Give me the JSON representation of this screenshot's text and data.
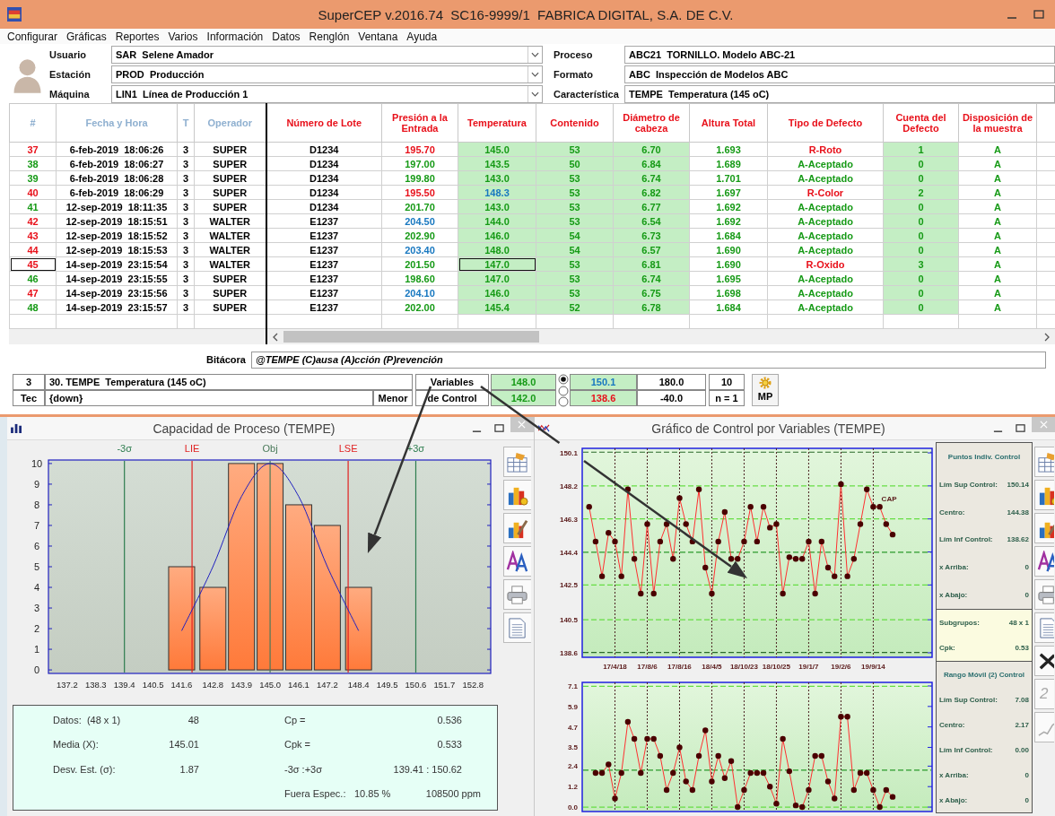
{
  "window": {
    "title": "SuperCEP v.2016.74  SC16-9999/1  FABRICA DIGITAL, S.A. DE C.V."
  },
  "menu": [
    "Configurar",
    "Gráficas",
    "Reportes",
    "Varios",
    "Información",
    "Datos",
    "Renglón",
    "Ventana",
    "Ayuda"
  ],
  "header": {
    "left": [
      {
        "label": "Usuario",
        "value": "SAR  Selene Amador"
      },
      {
        "label": "Estación",
        "value": "PROD  Producción"
      },
      {
        "label": "Máquina",
        "value": "LIN1  Línea de Producción 1"
      }
    ],
    "right": [
      {
        "label": "Proceso",
        "value": "ABC21  TORNILLO. Modelo ABC-21"
      },
      {
        "label": "Formato",
        "value": "ABC  Inspección de Modelos ABC"
      },
      {
        "label": "Característica",
        "value": "TEMPE  Temperatura (145 oC)"
      }
    ]
  },
  "table": {
    "columns": [
      {
        "label": "#",
        "color": "#8fb0d0",
        "shaded": false,
        "focused": false
      },
      {
        "label": "Fecha y Hora",
        "color": "#8fb0d0",
        "shaded": false,
        "focused": false
      },
      {
        "label": "T",
        "color": "#8fb0d0",
        "shaded": false,
        "focused": false
      },
      {
        "label": "Operador",
        "color": "#8fb0d0",
        "shaded": false,
        "focused": false
      },
      {
        "label": "Número de Lote",
        "color": "#e8101a",
        "shaded": false,
        "focused": false
      },
      {
        "label": "Presión a la Entrada",
        "color": "#e8101a",
        "shaded": false,
        "focused": false
      },
      {
        "label": "Temperatura",
        "color": "#e8101a",
        "shaded": true,
        "focused": true
      },
      {
        "label": "Contenido",
        "color": "#e8101a",
        "shaded": true,
        "focused": false
      },
      {
        "label": "Diámetro de cabeza",
        "color": "#e8101a",
        "shaded": true,
        "focused": false
      },
      {
        "label": "Altura Total",
        "color": "#e8101a",
        "shaded": false,
        "focused": false
      },
      {
        "label": "Tipo de Defecto",
        "color": "#e8101a",
        "shaded": false,
        "focused": false
      },
      {
        "label": "Cuenta del Defecto",
        "color": "#e8101a",
        "shaded": true,
        "focused": false
      },
      {
        "label": "Disposición de la muestra",
        "color": "#e8101a",
        "shaded": false,
        "focused": false
      }
    ],
    "rows": [
      {
        "selected": false,
        "cells": [
          {
            "text": "37",
            "color": "#e8101a"
          },
          {
            "text": "6-feb-2019  18:06:26"
          },
          {
            "text": "3"
          },
          {
            "text": "SUPER"
          },
          {
            "text": "D1234"
          },
          {
            "text": "195.70",
            "color": "#e8101a"
          },
          {
            "text": "145.0",
            "color": "#169a16"
          },
          {
            "text": "53",
            "color": "#169a16"
          },
          {
            "text": "6.70",
            "color": "#169a16"
          },
          {
            "text": "1.693",
            "color": "#169a16"
          },
          {
            "text": "R-Roto",
            "color": "#e8101a"
          },
          {
            "text": "1",
            "color": "#169a16"
          },
          {
            "text": "A",
            "color": "#169a16"
          }
        ]
      },
      {
        "selected": false,
        "cells": [
          {
            "text": "38",
            "color": "#169a16"
          },
          {
            "text": "6-feb-2019  18:06:27"
          },
          {
            "text": "3"
          },
          {
            "text": "SUPER"
          },
          {
            "text": "D1234"
          },
          {
            "text": "197.00",
            "color": "#169a16"
          },
          {
            "text": "143.5",
            "color": "#169a16"
          },
          {
            "text": "50",
            "color": "#169a16"
          },
          {
            "text": "6.84",
            "color": "#169a16"
          },
          {
            "text": "1.689",
            "color": "#169a16"
          },
          {
            "text": "A-Aceptado",
            "color": "#169a16"
          },
          {
            "text": "0",
            "color": "#169a16"
          },
          {
            "text": "A",
            "color": "#169a16"
          }
        ]
      },
      {
        "selected": false,
        "cells": [
          {
            "text": "39",
            "color": "#169a16"
          },
          {
            "text": "6-feb-2019  18:06:28"
          },
          {
            "text": "3"
          },
          {
            "text": "SUPER"
          },
          {
            "text": "D1234"
          },
          {
            "text": "199.80",
            "color": "#169a16"
          },
          {
            "text": "143.0",
            "color": "#169a16"
          },
          {
            "text": "53",
            "color": "#169a16"
          },
          {
            "text": "6.74",
            "color": "#169a16"
          },
          {
            "text": "1.701",
            "color": "#169a16"
          },
          {
            "text": "A-Aceptado",
            "color": "#169a16"
          },
          {
            "text": "0",
            "color": "#169a16"
          },
          {
            "text": "A",
            "color": "#169a16"
          }
        ]
      },
      {
        "selected": false,
        "cells": [
          {
            "text": "40",
            "color": "#e8101a"
          },
          {
            "text": "6-feb-2019  18:06:29"
          },
          {
            "text": "3"
          },
          {
            "text": "SUPER"
          },
          {
            "text": "D1234"
          },
          {
            "text": "195.50",
            "color": "#e8101a"
          },
          {
            "text": "148.3",
            "color": "#1878c0"
          },
          {
            "text": "53",
            "color": "#169a16"
          },
          {
            "text": "6.82",
            "color": "#169a16"
          },
          {
            "text": "1.697",
            "color": "#169a16"
          },
          {
            "text": "R-Color",
            "color": "#e8101a"
          },
          {
            "text": "2",
            "color": "#169a16"
          },
          {
            "text": "A",
            "color": "#169a16"
          }
        ]
      },
      {
        "selected": false,
        "cells": [
          {
            "text": "41",
            "color": "#169a16"
          },
          {
            "text": "12-sep-2019  18:11:35"
          },
          {
            "text": "3"
          },
          {
            "text": "SUPER"
          },
          {
            "text": "D1234"
          },
          {
            "text": "201.70",
            "color": "#169a16"
          },
          {
            "text": "143.0",
            "color": "#169a16"
          },
          {
            "text": "53",
            "color": "#169a16"
          },
          {
            "text": "6.77",
            "color": "#169a16"
          },
          {
            "text": "1.692",
            "color": "#169a16"
          },
          {
            "text": "A-Aceptado",
            "color": "#169a16"
          },
          {
            "text": "0",
            "color": "#169a16"
          },
          {
            "text": "A",
            "color": "#169a16"
          }
        ]
      },
      {
        "selected": false,
        "cells": [
          {
            "text": "42",
            "color": "#e8101a"
          },
          {
            "text": "12-sep-2019  18:15:51"
          },
          {
            "text": "3"
          },
          {
            "text": "WALTER"
          },
          {
            "text": "E1237"
          },
          {
            "text": "204.50",
            "color": "#1878c0"
          },
          {
            "text": "144.0",
            "color": "#169a16"
          },
          {
            "text": "53",
            "color": "#169a16"
          },
          {
            "text": "6.54",
            "color": "#169a16"
          },
          {
            "text": "1.692",
            "color": "#169a16"
          },
          {
            "text": "A-Aceptado",
            "color": "#169a16"
          },
          {
            "text": "0",
            "color": "#169a16"
          },
          {
            "text": "A",
            "color": "#169a16"
          }
        ]
      },
      {
        "selected": false,
        "cells": [
          {
            "text": "43",
            "color": "#e8101a"
          },
          {
            "text": "12-sep-2019  18:15:52"
          },
          {
            "text": "3"
          },
          {
            "text": "WALTER"
          },
          {
            "text": "E1237"
          },
          {
            "text": "202.90",
            "color": "#169a16"
          },
          {
            "text": "146.0",
            "color": "#169a16"
          },
          {
            "text": "54",
            "color": "#169a16"
          },
          {
            "text": "6.73",
            "color": "#169a16"
          },
          {
            "text": "1.684",
            "color": "#169a16"
          },
          {
            "text": "A-Aceptado",
            "color": "#169a16"
          },
          {
            "text": "0",
            "color": "#169a16"
          },
          {
            "text": "A",
            "color": "#169a16"
          }
        ]
      },
      {
        "selected": false,
        "cells": [
          {
            "text": "44",
            "color": "#e8101a"
          },
          {
            "text": "12-sep-2019  18:15:53"
          },
          {
            "text": "3"
          },
          {
            "text": "WALTER"
          },
          {
            "text": "E1237"
          },
          {
            "text": "203.40",
            "color": "#1878c0"
          },
          {
            "text": "148.0",
            "color": "#169a16"
          },
          {
            "text": "54",
            "color": "#169a16"
          },
          {
            "text": "6.57",
            "color": "#169a16"
          },
          {
            "text": "1.690",
            "color": "#169a16"
          },
          {
            "text": "A-Aceptado",
            "color": "#169a16"
          },
          {
            "text": "0",
            "color": "#169a16"
          },
          {
            "text": "A",
            "color": "#169a16"
          }
        ]
      },
      {
        "selected": true,
        "cells": [
          {
            "text": "45",
            "color": "#e8101a"
          },
          {
            "text": "14-sep-2019  23:15:54"
          },
          {
            "text": "3"
          },
          {
            "text": "WALTER"
          },
          {
            "text": "E1237"
          },
          {
            "text": "201.50",
            "color": "#169a16"
          },
          {
            "text": "147.0",
            "color": "#169a16"
          },
          {
            "text": "53",
            "color": "#169a16"
          },
          {
            "text": "6.81",
            "color": "#169a16"
          },
          {
            "text": "1.690",
            "color": "#169a16"
          },
          {
            "text": "R-Oxido",
            "color": "#e8101a"
          },
          {
            "text": "3",
            "color": "#169a16"
          },
          {
            "text": "A",
            "color": "#169a16"
          }
        ]
      },
      {
        "selected": false,
        "cells": [
          {
            "text": "46",
            "color": "#169a16"
          },
          {
            "text": "14-sep-2019  23:15:55"
          },
          {
            "text": "3"
          },
          {
            "text": "SUPER"
          },
          {
            "text": "E1237"
          },
          {
            "text": "198.60",
            "color": "#169a16"
          },
          {
            "text": "147.0",
            "color": "#169a16"
          },
          {
            "text": "53",
            "color": "#169a16"
          },
          {
            "text": "6.74",
            "color": "#169a16"
          },
          {
            "text": "1.695",
            "color": "#169a16"
          },
          {
            "text": "A-Aceptado",
            "color": "#169a16"
          },
          {
            "text": "0",
            "color": "#169a16"
          },
          {
            "text": "A",
            "color": "#169a16"
          }
        ]
      },
      {
        "selected": false,
        "cells": [
          {
            "text": "47",
            "color": "#e8101a"
          },
          {
            "text": "14-sep-2019  23:15:56"
          },
          {
            "text": "3"
          },
          {
            "text": "SUPER"
          },
          {
            "text": "E1237"
          },
          {
            "text": "204.10",
            "color": "#1878c0"
          },
          {
            "text": "146.0",
            "color": "#169a16"
          },
          {
            "text": "53",
            "color": "#169a16"
          },
          {
            "text": "6.75",
            "color": "#169a16"
          },
          {
            "text": "1.698",
            "color": "#169a16"
          },
          {
            "text": "A-Aceptado",
            "color": "#169a16"
          },
          {
            "text": "0",
            "color": "#169a16"
          },
          {
            "text": "A",
            "color": "#169a16"
          }
        ]
      },
      {
        "selected": false,
        "cells": [
          {
            "text": "48",
            "color": "#169a16"
          },
          {
            "text": "14-sep-2019  23:15:57"
          },
          {
            "text": "3"
          },
          {
            "text": "SUPER"
          },
          {
            "text": "E1237"
          },
          {
            "text": "202.00",
            "color": "#169a16"
          },
          {
            "text": "145.4",
            "color": "#169a16"
          },
          {
            "text": "52",
            "color": "#169a16"
          },
          {
            "text": "6.78",
            "color": "#169a16"
          },
          {
            "text": "1.684",
            "color": "#169a16"
          },
          {
            "text": "A-Aceptado",
            "color": "#169a16"
          },
          {
            "text": "0",
            "color": "#169a16"
          },
          {
            "text": "A",
            "color": "#169a16"
          }
        ]
      }
    ]
  },
  "log": {
    "label": "Bitácora",
    "value": "@TEMPE (C)ausa (A)cción (P)revención"
  },
  "info_bar": {
    "number": "3",
    "type": "Tec",
    "characteristic": "30. TEMPE  Temperatura (145 oC)",
    "direction": "{down}",
    "unit": "Menor",
    "chart_type": [
      "Variables",
      "de Control"
    ],
    "radios": [
      {
        "selected": true
      },
      {
        "selected": false
      },
      {
        "selected": false
      }
    ],
    "groups": [
      {
        "shaded": true,
        "cells": [
          {
            "text": "148.0",
            "color": "#169a16"
          },
          {
            "text": "142.0",
            "color": "#169a16"
          }
        ]
      },
      {
        "shaded": true,
        "cells": [
          {
            "text": "150.1",
            "color": "#1878c0"
          },
          {
            "text": "138.6",
            "color": "#e8101a"
          }
        ]
      },
      {
        "shaded": false,
        "cells": [
          {
            "text": "180.0",
            "color": "#000000"
          },
          {
            "text": "-40.0",
            "color": "#000000"
          }
        ]
      },
      {
        "shaded": false,
        "cells": [
          {
            "text": "10",
            "color": "#000000"
          },
          {
            "text": "n = 1",
            "color": "#000000"
          }
        ]
      }
    ],
    "button": "MP"
  },
  "capability": {
    "title": "Capacidad de Proceso (TEMPE)",
    "chart_data": {
      "type": "bar",
      "x": [
        141.6,
        142.8,
        143.9,
        145.0,
        146.1,
        147.2,
        148.4
      ],
      "series": [
        {
          "values": [
            5,
            4,
            10,
            10,
            8,
            7,
            4
          ]
        },
        {
          "type": "line",
          "color": "#2020c0",
          "values": [
            1.9,
            5.0,
            8.4,
            10.0,
            8.4,
            5.0,
            1.9
          ]
        }
      ],
      "xticks": [
        137.2,
        138.3,
        139.4,
        140.5,
        141.6,
        142.8,
        143.9,
        {
          "value": 145.0,
          "label": "145.0"
        },
        146.1,
        147.2,
        148.4,
        149.5,
        150.6,
        151.7,
        152.8
      ],
      "yticks": [
        0,
        1,
        2,
        3,
        4,
        5,
        6,
        7,
        8,
        9,
        10
      ],
      "xlim": [
        136.48,
        153.48
      ],
      "ylim": [
        -0.17,
        10.17
      ],
      "ref_lines": [
        {
          "axis": "x",
          "value": 139.4,
          "label": "-3σ",
          "color": "#2e7d4f"
        },
        {
          "axis": "x",
          "value": 142.0,
          "label": "LIE",
          "color": "#e02020"
        },
        {
          "axis": "x",
          "value": 145.0,
          "label": "Obj",
          "color": "#4a7a5a"
        },
        {
          "axis": "x",
          "value": 148.0,
          "label": "LSE",
          "color": "#e02020"
        },
        {
          "axis": "x",
          "value": 150.6,
          "label": "+3σ",
          "color": "#2e7d4f"
        }
      ]
    },
    "stats": [
      {
        "label": "Datos:  (48 x 1)",
        "value": "48",
        "label2": "Cp =",
        "value2": "0.536"
      },
      {
        "label": "Media (X):",
        "value": "145.01",
        "label2": "Cpk =",
        "value2": "0.533"
      },
      {
        "label": "Desv. Est. (σ):",
        "value": "1.87",
        "label2": "-3σ :+3σ",
        "value2": "139.41 : 150.62"
      }
    ],
    "out_of_spec": {
      "label": "Fuera Espec.:",
      "percent": "10.85 %",
      "ppm": "108500 ppm"
    }
  },
  "control": {
    "title": "Gráfico de Control por Variables (TEMPE)",
    "charts": [
      {
        "chart_data": {
          "type": "line",
          "categories": [
            null,
            null,
            null,
            null,
            "17/4/18",
            null,
            null,
            null,
            null,
            "17/8/6",
            null,
            null,
            null,
            null,
            "17/8/16",
            null,
            null,
            null,
            null,
            "18/4/5",
            null,
            null,
            null,
            null,
            "18/10/23",
            null,
            null,
            null,
            null,
            "18/10/25",
            null,
            null,
            null,
            null,
            "19/1/7",
            null,
            null,
            null,
            null,
            "19/2/6",
            null,
            null,
            null,
            null,
            "19/9/14",
            null,
            null,
            null
          ],
          "values": [
            147.0,
            145.0,
            143.0,
            145.5,
            145.0,
            143.0,
            148.0,
            144.0,
            142.0,
            146.0,
            142.0,
            145.0,
            146.0,
            144.0,
            147.5,
            146.0,
            145.0,
            148.0,
            143.5,
            142.0,
            145.0,
            146.7,
            144.0,
            144.0,
            145.0,
            147.0,
            145.0,
            147.0,
            145.8,
            146.0,
            142.0,
            144.1,
            144.0,
            144.0,
            145.0,
            142.0,
            145.0,
            143.5,
            143.0,
            148.3,
            143.0,
            144.0,
            146.0,
            148.0,
            147.0,
            147.0,
            146.0,
            145.4
          ],
          "yticks": [
            138.6,
            140.5,
            142.5,
            144.4,
            146.3,
            148.2,
            150.1
          ],
          "ylim": [
            138.34,
            150.36
          ],
          "grid": true,
          "marker": true,
          "ref_lines": [
            {
              "axis": "y",
              "value": 150.14,
              "color": "#2a6a2a"
            },
            {
              "axis": "y",
              "value": 148.2,
              "color": "#66dd44"
            },
            {
              "axis": "y",
              "value": 146.3,
              "color": "#66dd44"
            },
            {
              "axis": "y",
              "value": 144.38,
              "color": "#2a9a2a"
            },
            {
              "axis": "y",
              "value": 142.5,
              "color": "#66dd44"
            },
            {
              "axis": "y",
              "value": 140.5,
              "color": "#66dd44"
            },
            {
              "axis": "y",
              "value": 138.62,
              "color": "#2a6a2a"
            }
          ],
          "annotations": [
            "CAP"
          ]
        }
      },
      {
        "chart_data": {
          "type": "line",
          "categories": [
            null,
            null,
            null,
            null,
            null,
            null,
            null,
            null,
            null,
            null,
            null,
            null,
            null,
            null,
            null,
            null,
            null,
            null,
            null,
            null,
            null,
            null,
            null,
            null,
            null,
            null,
            null,
            null,
            null,
            null,
            null,
            null,
            null,
            null,
            null,
            null,
            null,
            null,
            null,
            null,
            null,
            null,
            null,
            null,
            null,
            null,
            null,
            null
          ],
          "values": [
            null,
            2.0,
            2.0,
            2.5,
            0.5,
            2.0,
            5.0,
            4.0,
            2.0,
            4.0,
            4.0,
            3.0,
            1.0,
            2.0,
            3.5,
            1.5,
            1.0,
            3.0,
            4.5,
            1.5,
            3.0,
            1.7,
            2.7,
            0.0,
            1.0,
            2.0,
            2.0,
            2.0,
            1.2,
            0.2,
            4.0,
            2.1,
            0.1,
            0.0,
            1.0,
            3.0,
            3.0,
            1.5,
            0.5,
            5.3,
            5.3,
            1.0,
            2.0,
            2.0,
            1.0,
            0.0,
            1.0,
            0.6
          ],
          "yticks": [
            {
              "value": 0,
              "label": "0.0"
            },
            1.2,
            2.4,
            3.5,
            4.7,
            5.9,
            7.1
          ],
          "ylim": [
            -0.26,
            7.31
          ],
          "grid": true,
          "marker": true,
          "ref_lines": [
            {
              "axis": "y",
              "value": 7.08,
              "color": "#66dd44"
            },
            {
              "axis": "y",
              "value": 2.17,
              "color": "#2a9a2a"
            },
            {
              "axis": "y",
              "value": 0.0,
              "color": "#66dd44"
            }
          ]
        }
      }
    ],
    "panel": [
      {
        "title": "Puntos Indiv. Control",
        "highlight": false,
        "rows": [
          {
            "label": "Lím Sup Control:",
            "value": "150.14"
          },
          {
            "label": "Centro:",
            "value": "144.38"
          },
          {
            "label": "Lím Inf Control:",
            "value": "138.62"
          },
          {
            "label": "x Arriba:",
            "value": "0"
          },
          {
            "label": "x Abajo:",
            "value": "0"
          }
        ]
      },
      {
        "highlight": true,
        "rows": [
          {
            "label": "Subgrupos:",
            "value": "48 x 1"
          },
          {
            "label": "Cpk:",
            "value": "0.53"
          }
        ]
      },
      {
        "title": "Rango Móvil (2) Control",
        "highlight": false,
        "rows": [
          {
            "label": "Lím Sup Control:",
            "value": "7.08"
          },
          {
            "label": "Centro:",
            "value": "2.17"
          },
          {
            "label": "Lím Inf Control:",
            "value": "0.00"
          },
          {
            "label": "x Arriba:",
            "value": "0"
          },
          {
            "label": "x Abajo:",
            "value": "0"
          }
        ]
      }
    ],
    "toolbar_label": "2"
  }
}
